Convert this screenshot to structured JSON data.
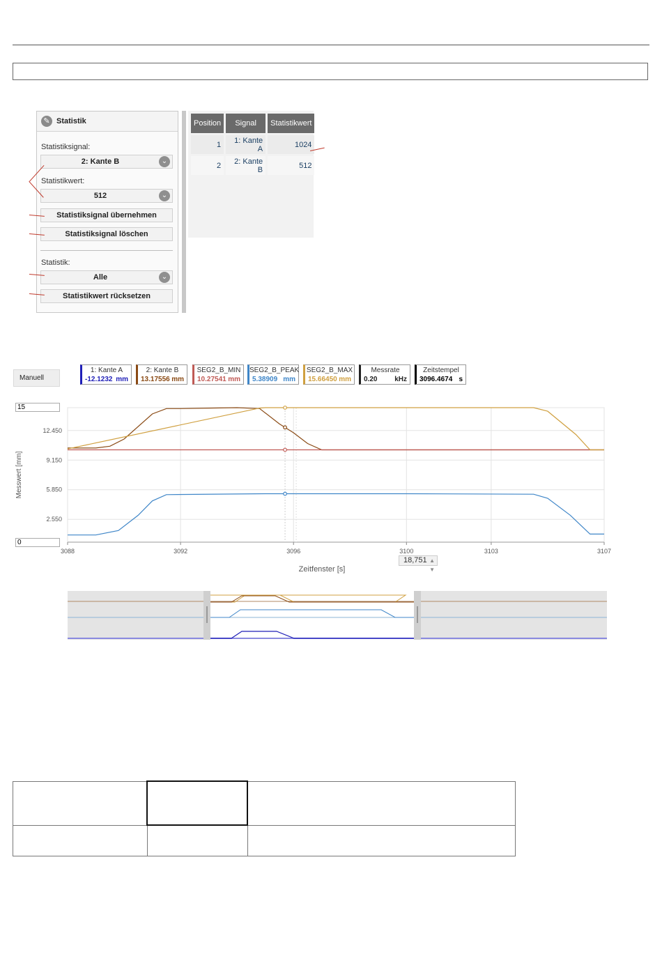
{
  "stat_panel": {
    "title": "Statistik",
    "signal_label": "Statistiksignal:",
    "signal_value": "2: Kante B",
    "wert_label": "Statistikwert:",
    "wert_value": "512",
    "btn_apply": "Statistiksignal übernehmen",
    "btn_delete": "Statistiksignal löschen",
    "statistik_label": "Statistik:",
    "statistik_value": "Alle",
    "btn_reset": "Statistikwert rücksetzen",
    "icons": {
      "edit": "pencil-icon",
      "dropdown": "chevron-down-icon"
    }
  },
  "stat_table": {
    "headers": [
      "Position",
      "Signal",
      "Statistikwert"
    ],
    "rows": [
      {
        "position": "1",
        "signal": "1: Kante A",
        "value": "1024"
      },
      {
        "position": "2",
        "signal": "2: Kante B",
        "value": "512"
      }
    ]
  },
  "mode_button": "Manuell",
  "legend": [
    {
      "name": "1: Kante A",
      "value": "-12.1232",
      "unit": "mm",
      "color": "#1f1fb8"
    },
    {
      "name": "2: Kante B",
      "value": "13.17556",
      "unit": "mm",
      "color": "#8a4a14"
    },
    {
      "name": "SEG2_B_MIN",
      "value": "10.27541",
      "unit": "mm",
      "color": "#c05a55"
    },
    {
      "name": "SEG2_B_PEAK",
      "value": "5.38909",
      "unit": "mm",
      "color": "#3f86c8"
    },
    {
      "name": "SEG2_B_MAX",
      "value": "15.66450",
      "unit": "mm",
      "color": "#d0a040"
    },
    {
      "name": "Messrate",
      "value": "0.20",
      "unit": "kHz",
      "color": "#222222"
    },
    {
      "name": "Zeitstempel",
      "value": "3096.4674",
      "unit": "s",
      "color": "#000000"
    }
  ],
  "y_max_input": "15",
  "y_min_input": "0",
  "zoom_value": "18,751",
  "chart_data": {
    "type": "line",
    "xlabel": "Zeitfenster [s]",
    "ylabel": "Messwert [mm]",
    "xlim": [
      3088,
      3107
    ],
    "ylim": [
      0,
      15
    ],
    "x_tick_labels": [
      "3088",
      "3092",
      "3096",
      "3100",
      "3103",
      "3107"
    ],
    "y_tick_labels": [
      "0",
      "2.550",
      "5.850",
      "9.150",
      "12.450",
      "15"
    ],
    "cursor_x": 3095.7,
    "grid": true,
    "series": [
      {
        "name": "2: Kante B",
        "color": "#8a4a14",
        "x": [
          3088,
          3089,
          3089.5,
          3090,
          3091,
          3091.5,
          3092,
          3093,
          3094,
          3094.8,
          3095.5,
          3096,
          3096.5,
          3097,
          3107
        ],
        "y": [
          10.5,
          10.5,
          10.7,
          11.5,
          14.3,
          14.9,
          14.9,
          14.95,
          15.0,
          14.9,
          13.2,
          12.2,
          11.0,
          10.3,
          10.3
        ]
      },
      {
        "name": "SEG2_B_MIN",
        "color": "#c05a55",
        "x": [
          3088,
          3107
        ],
        "y": [
          10.3,
          10.3
        ]
      },
      {
        "name": "SEG2_B_MAX",
        "color": "#d0a040",
        "x": [
          3088,
          3094.8,
          3095,
          3104.5,
          3105,
          3106,
          3106.5,
          3107
        ],
        "y": [
          10.4,
          14.95,
          15.0,
          15.0,
          14.6,
          12.0,
          10.3,
          10.3
        ]
      },
      {
        "name": "SEG2_B_PEAK",
        "color": "#3f86c8",
        "x": [
          3088,
          3089,
          3089.8,
          3090.5,
          3091,
          3091.5,
          3095,
          3100,
          3104.5,
          3105,
          3105.8,
          3106.5,
          3107
        ],
        "y": [
          0.8,
          0.8,
          1.3,
          3.0,
          4.6,
          5.3,
          5.4,
          5.4,
          5.35,
          4.9,
          3.0,
          0.9,
          0.9
        ]
      }
    ]
  }
}
